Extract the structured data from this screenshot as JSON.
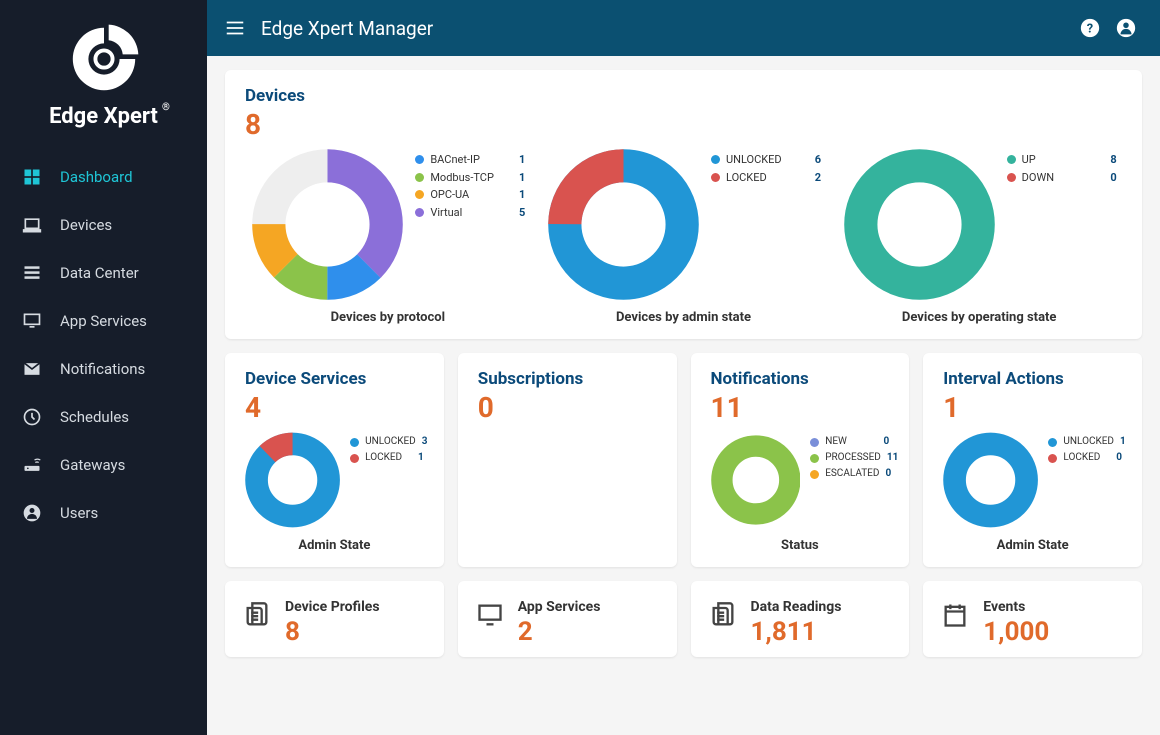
{
  "brand": {
    "name": "Edge Xpert"
  },
  "header": {
    "title": "Edge Xpert Manager"
  },
  "sidebar": {
    "items": [
      {
        "label": "Dashboard",
        "icon": "dashboard-icon",
        "active": true
      },
      {
        "label": "Devices",
        "icon": "laptop-icon"
      },
      {
        "label": "Data Center",
        "icon": "list-icon"
      },
      {
        "label": "App Services",
        "icon": "monitor-icon"
      },
      {
        "label": "Notifications",
        "icon": "mail-icon"
      },
      {
        "label": "Schedules",
        "icon": "clock-icon"
      },
      {
        "label": "Gateways",
        "icon": "router-icon"
      },
      {
        "label": "Users",
        "icon": "user-icon"
      }
    ]
  },
  "devices_card": {
    "title": "Devices",
    "total": "8",
    "by_protocol": {
      "caption": "Devices by protocol"
    },
    "by_admin": {
      "caption": "Devices by admin state"
    },
    "by_operating": {
      "caption": "Devices by operating state"
    }
  },
  "small_cards": {
    "device_services": {
      "title": "Device Services",
      "total": "4",
      "caption": "Admin State"
    },
    "subscriptions": {
      "title": "Subscriptions",
      "total": "0"
    },
    "notifications": {
      "title": "Notifications",
      "total": "11",
      "caption": "Status"
    },
    "interval_actions": {
      "title": "Interval Actions",
      "total": "1",
      "caption": "Admin State"
    }
  },
  "stat_cards": {
    "device_profiles": {
      "label": "Device Profiles",
      "value": "8"
    },
    "app_services": {
      "label": "App Services",
      "value": "2"
    },
    "data_readings": {
      "label": "Data Readings",
      "value": "1,811"
    },
    "events": {
      "label": "Events",
      "value": "1,000"
    }
  },
  "colors": {
    "blue": "#2f8fec",
    "green": "#8bc34a",
    "orange": "#f5a623",
    "purple": "#8b6fd9",
    "teal": "#34b39d",
    "red": "#d9534f",
    "skyblue": "#2196d6",
    "lime": "#8bc34a"
  },
  "chart_data": [
    {
      "id": "devices_by_protocol",
      "type": "pie",
      "title": "Devices by protocol",
      "series": [
        {
          "name": "BACnet-IP",
          "value": 1,
          "color": "#2f8fec"
        },
        {
          "name": "Modbus-TCP",
          "value": 1,
          "color": "#8bc34a"
        },
        {
          "name": "OPC-UA",
          "value": 1,
          "color": "#f5a623"
        },
        {
          "name": "Virtual",
          "value": 5,
          "color": "#8b6fd9"
        }
      ]
    },
    {
      "id": "devices_by_admin_state",
      "type": "pie",
      "title": "Devices by admin state",
      "series": [
        {
          "name": "UNLOCKED",
          "value": 6,
          "color": "#2196d6"
        },
        {
          "name": "LOCKED",
          "value": 2,
          "color": "#d9534f"
        }
      ]
    },
    {
      "id": "devices_by_operating_state",
      "type": "pie",
      "title": "Devices by operating state",
      "series": [
        {
          "name": "UP",
          "value": 8,
          "color": "#34b39d"
        },
        {
          "name": "DOWN",
          "value": 0,
          "color": "#d9534f"
        }
      ]
    },
    {
      "id": "device_services_admin_state",
      "type": "pie",
      "title": "Admin State",
      "series": [
        {
          "name": "UNLOCKED",
          "value": 3,
          "color": "#2196d6"
        },
        {
          "name": "LOCKED",
          "value": 1,
          "color": "#d9534f"
        }
      ]
    },
    {
      "id": "notifications_status",
      "type": "pie",
      "title": "Status",
      "series": [
        {
          "name": "NEW",
          "value": 0,
          "color": "#7a8fd9"
        },
        {
          "name": "PROCESSED",
          "value": 11,
          "color": "#8bc34a"
        },
        {
          "name": "ESCALATED",
          "value": 0,
          "color": "#f5a623"
        }
      ]
    },
    {
      "id": "interval_actions_admin_state",
      "type": "pie",
      "title": "Admin State",
      "series": [
        {
          "name": "UNLOCKED",
          "value": 1,
          "color": "#2196d6"
        },
        {
          "name": "LOCKED",
          "value": 0,
          "color": "#d9534f"
        }
      ]
    }
  ]
}
